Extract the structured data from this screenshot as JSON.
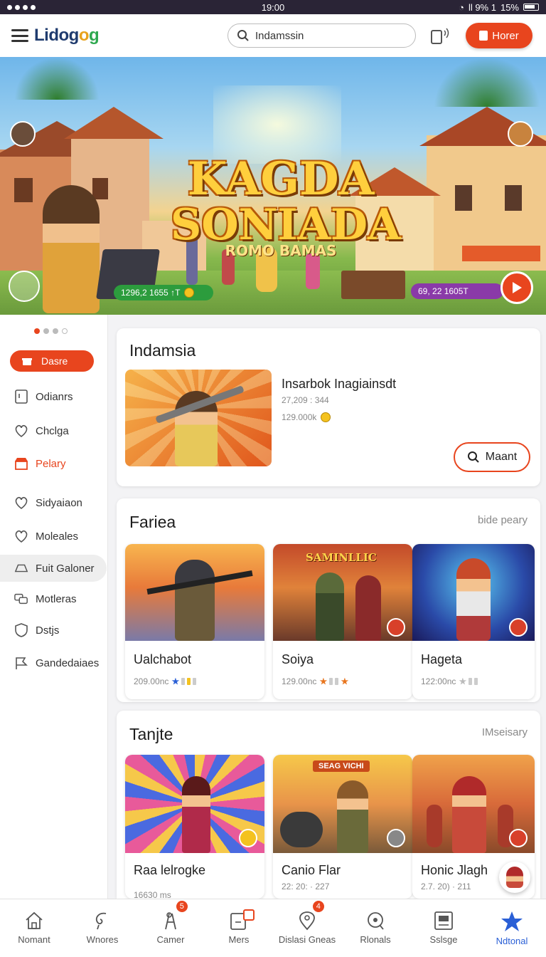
{
  "status_bar": {
    "time": "19:00",
    "indicators": "ll 9% 1",
    "battery": "15%"
  },
  "header": {
    "logo_text": "Lidog",
    "logo_suffix_a": "o",
    "logo_suffix_b": "g",
    "search": {
      "value": "Indamssin",
      "placeholder": "Indamssin"
    },
    "home_button": "Horer"
  },
  "hero": {
    "title_line1": "KAGDA",
    "title_line2": "SONIADA",
    "title_line3": "ROMO BAMAS",
    "chip_left": "1296,2 1655 ↑T",
    "chip_right": "69, 22 1605T",
    "pager": {
      "total": 4,
      "active": 0
    }
  },
  "sidebar": {
    "items": [
      {
        "label": "Dasre",
        "icon": "gift-icon"
      },
      {
        "label": "Odianrs",
        "icon": "tablet-icon"
      },
      {
        "label": "Chclga",
        "icon": "heart-shield-icon"
      },
      {
        "label": "Pelary",
        "icon": "store-icon"
      },
      {
        "label": "Sidyaiaon",
        "icon": "heart-shield-icon"
      },
      {
        "label": "Moleales",
        "icon": "heart-shield-icon"
      },
      {
        "label": "Fuit Galoner",
        "icon": "gamepad-icon"
      },
      {
        "label": "Motleras",
        "icon": "chat-icon"
      },
      {
        "label": "Dstjs",
        "icon": "shield-icon"
      },
      {
        "label": "Gandedaiaes",
        "icon": "flag-icon"
      }
    ]
  },
  "featured": {
    "section_title": "Indamsia",
    "game_title": "Insarbok Inagiainsdt",
    "meta_line1": "27,209 : 344",
    "meta_line2": "129.000k",
    "button_label": "Maant"
  },
  "fariea": {
    "section_title": "Fariea",
    "more": "bide peary",
    "tiles": [
      {
        "name": "Ualchabot",
        "meta": "209.00nc"
      },
      {
        "name": "Soiya",
        "meta": "129.00nc",
        "banner": "SAMINLLIC"
      },
      {
        "name": "Hageta",
        "meta": "122:00nc"
      }
    ]
  },
  "tanjte": {
    "section_title": "Tanjte",
    "more": "IMseisary",
    "tiles": [
      {
        "name": "Raa lelrogke",
        "meta": "16630 ms"
      },
      {
        "name": "Canio Flar",
        "sub": "22: 20: · 227",
        "banner": "SEAG VICHI"
      },
      {
        "name": "Honic Jlagh",
        "sub": "2.7. 20) · 211"
      }
    ]
  },
  "bottom_nav": [
    {
      "label": "Nomant",
      "icon": "home-icon"
    },
    {
      "label": "Wnores",
      "icon": "swirl-icon"
    },
    {
      "label": "Camer",
      "icon": "tools-icon",
      "badge": "5"
    },
    {
      "label": "Mers",
      "icon": "calendar-icon",
      "badge": ""
    },
    {
      "label": "Dislasi Gneas",
      "icon": "location-icon",
      "badge": "4"
    },
    {
      "label": "Rlonals",
      "icon": "target-icon"
    },
    {
      "label": "Sslsge",
      "icon": "board-icon"
    },
    {
      "label": "Ndtonal",
      "icon": "star-icon"
    }
  ],
  "colors": {
    "accent": "#e8451e",
    "nav_active": "#2a5fd6",
    "status_bg": "#2a2436"
  }
}
